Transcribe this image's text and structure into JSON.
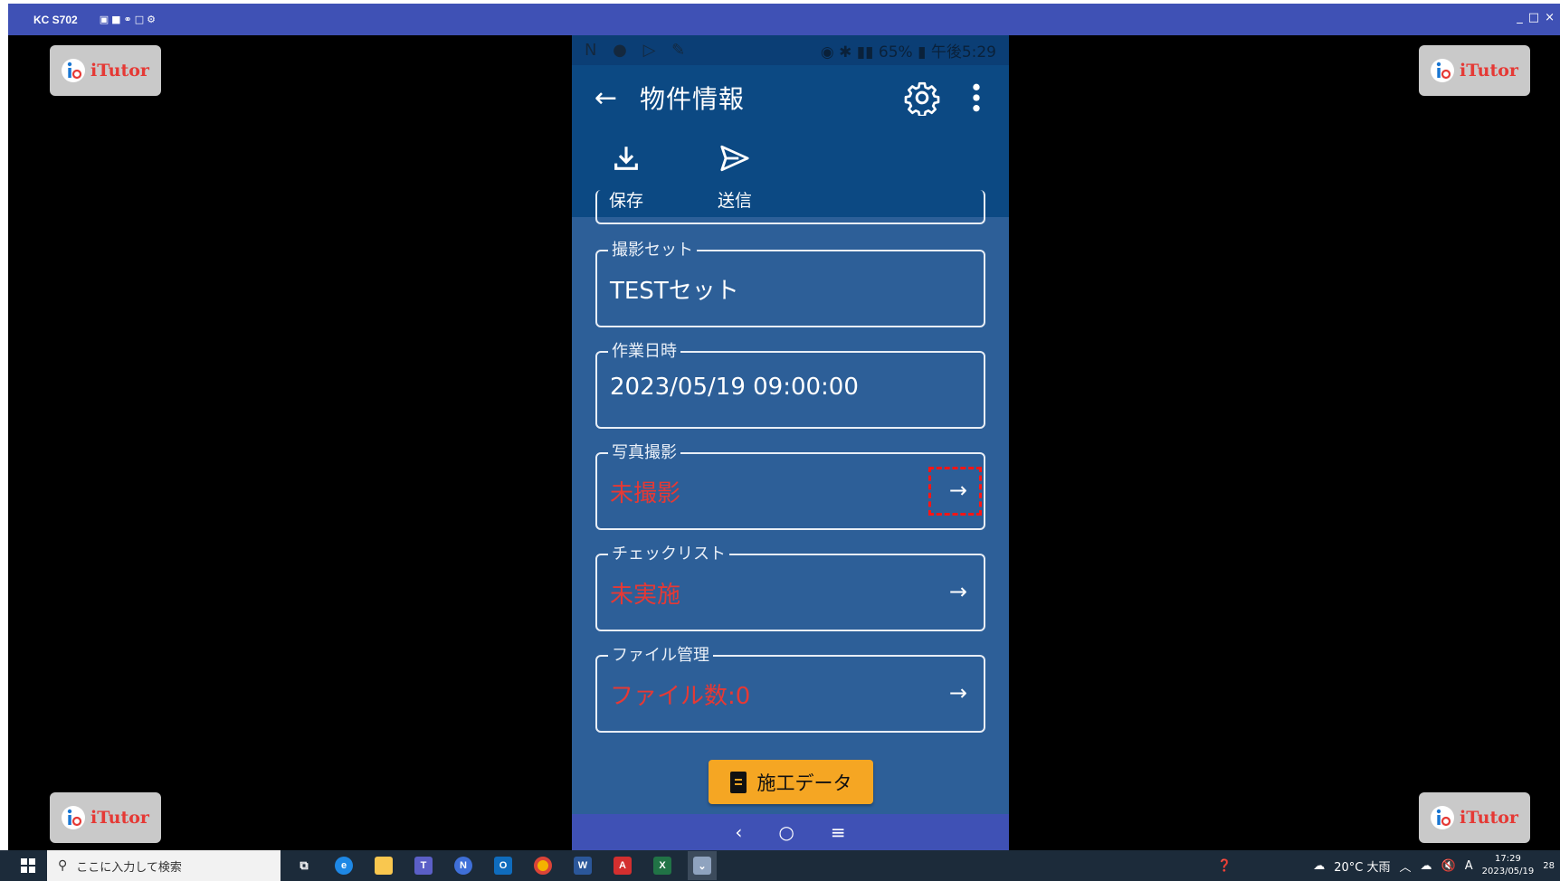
{
  "window": {
    "title": "KC S702",
    "toolbar_icons": [
      "camera-icon",
      "video-icon",
      "headset-icon",
      "fullscreen-icon",
      "gear-icon"
    ]
  },
  "watermark": {
    "text": "iTutor"
  },
  "phone": {
    "appbar": {
      "title": "物件情報"
    },
    "toolbar": {
      "save_label": "保存",
      "send_label": "送信"
    },
    "fields": [
      {
        "legend": "撮影セット",
        "value": "TESTセット",
        "value_status": "normal",
        "has_arrow": false
      },
      {
        "legend": "作業日時",
        "value": "2023/05/19 09:00:00",
        "value_status": "normal",
        "has_arrow": false
      },
      {
        "legend": "写真撮影",
        "value": "未撮影",
        "value_status": "warning",
        "has_arrow": true,
        "arrow": "→",
        "highlighted": true
      },
      {
        "legend": "チェックリスト",
        "value": "未実施",
        "value_status": "warning",
        "has_arrow": true,
        "arrow": "→"
      },
      {
        "legend": "ファイル管理",
        "value": "ファイル数:0",
        "value_status": "warning",
        "has_arrow": true,
        "arrow": "→"
      }
    ],
    "action_button": {
      "label": "施工データ"
    },
    "navbar": {
      "back": "‹",
      "home": "○",
      "recents": "≡"
    }
  },
  "taskbar": {
    "search_placeholder": "ここに入力して検索",
    "weather": "20°C 大雨",
    "ime": "A",
    "time": "17:29",
    "date": "2023/05/19",
    "notification_count": "28"
  },
  "colors": {
    "accent_red": "#e53935",
    "appbar": "#0c4983",
    "content_bg": "#2d5f98",
    "button": "#f5a623",
    "mirror_bar": "#3f51b5"
  }
}
